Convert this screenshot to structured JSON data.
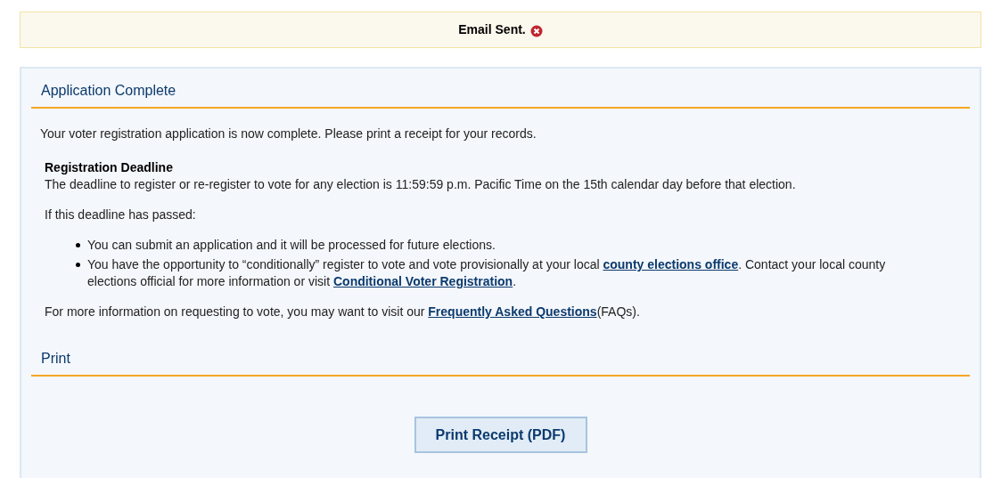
{
  "alert": {
    "message": "Email Sent."
  },
  "sections": [
    {
      "title": "Application Complete"
    },
    {
      "title": "Print"
    }
  ],
  "intro": "Your voter registration application is now complete. Please print a receipt for your records.",
  "deadline": {
    "heading": "Registration Deadline",
    "text": "The deadline to register or re-register to vote for any election is 11:59:59 p.m. Pacific Time on the 15th calendar day before that election."
  },
  "passed_label": "If this deadline has passed:",
  "bullets": [
    [
      {
        "kind": "text",
        "text": "You can submit an application and it will be processed for future elections."
      }
    ],
    [
      {
        "kind": "text",
        "text": "You have the opportunity to “conditionally” register to vote and vote provisionally at your local "
      },
      {
        "kind": "link",
        "text": "county elections office"
      },
      {
        "kind": "text",
        "text": ". Contact your local county elections official for more information or visit "
      },
      {
        "kind": "link",
        "text": "Conditional Voter Registration"
      },
      {
        "kind": "text",
        "text": "."
      }
    ]
  ],
  "more_info": [
    {
      "kind": "text",
      "text": "For more information on requesting to vote, you may want to visit our "
    },
    {
      "kind": "link",
      "text": "Frequently Asked Questions"
    },
    {
      "kind": "text",
      "text": "(FAQs)."
    }
  ],
  "print_button": "Print Receipt (PDF)"
}
